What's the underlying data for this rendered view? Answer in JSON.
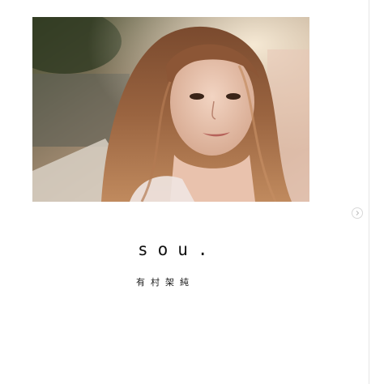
{
  "post": {
    "book_title": "sou.",
    "author_name": "有村架純"
  },
  "icons": {
    "next": "chevron-right-icon"
  },
  "colors": {
    "title_text": "#111111",
    "divider": "#e6e6e6",
    "background": "#ffffff"
  }
}
